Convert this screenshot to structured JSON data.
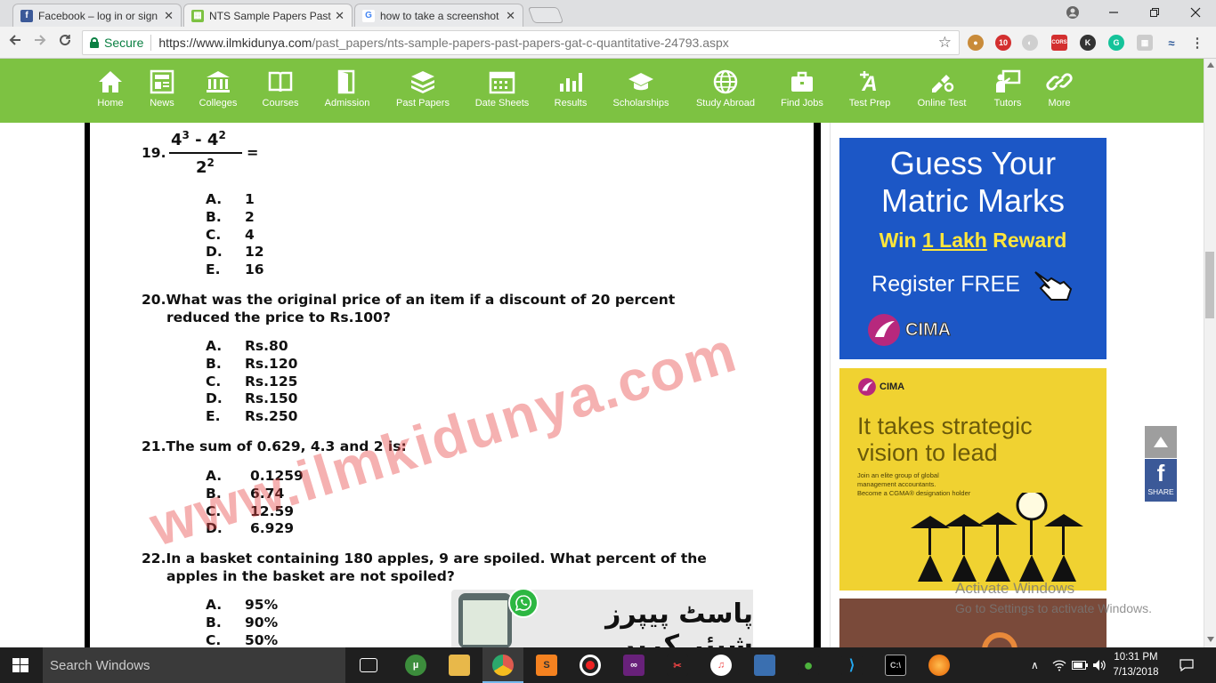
{
  "browser": {
    "tabs": [
      {
        "title": "Facebook – log in or sign",
        "icon_color": "#3b5998",
        "icon_glyph": "f"
      },
      {
        "title": "NTS Sample Papers Past P",
        "icon_color": "#7dc242",
        "icon_glyph": "▦"
      },
      {
        "title": "how to take a screenshot",
        "icon_color": "#ffffff",
        "icon_glyph": "G"
      }
    ],
    "tab_close": "✕",
    "secure_label": "Secure",
    "url_host": "https://www.ilmkidunya.com",
    "url_path": "/past_papers/nts-sample-papers-past-papers-gat-c-quantitative-24793.aspx",
    "ext_badge": "10",
    "ext_cors": "CORS",
    "ext_k": "K",
    "ext_g": "G"
  },
  "site_nav": [
    {
      "label": "Home",
      "icon": "home-icon"
    },
    {
      "label": "News",
      "icon": "news-icon"
    },
    {
      "label": "Colleges",
      "icon": "college-icon"
    },
    {
      "label": "Courses",
      "icon": "book-icon"
    },
    {
      "label": "Admission",
      "icon": "door-icon"
    },
    {
      "label": "Past Papers",
      "icon": "papers-icon"
    },
    {
      "label": "Date Sheets",
      "icon": "calendar-icon"
    },
    {
      "label": "Results",
      "icon": "results-chart-icon"
    },
    {
      "label": "Scholarships",
      "icon": "graduation-cap-icon"
    },
    {
      "label": "Study Abroad",
      "icon": "globe-icon"
    },
    {
      "label": "Find Jobs",
      "icon": "briefcase-icon"
    },
    {
      "label": "Test Prep",
      "icon": "test-prep-icon"
    },
    {
      "label": "Online Test",
      "icon": "online-test-icon"
    },
    {
      "label": "Tutors",
      "icon": "tutor-icon"
    },
    {
      "label": "More",
      "icon": "link-icon"
    }
  ],
  "paper": {
    "q19": {
      "number": "19.",
      "numerator_base1": "4",
      "numerator_exp1": "3",
      "minus": " - ",
      "numerator_base2": "4",
      "numerator_exp2": "2",
      "denominator_base": "2",
      "denominator_exp": "2",
      "equals": "=",
      "options": [
        {
          "letter": "A.",
          "value": "1"
        },
        {
          "letter": "B.",
          "value": "2"
        },
        {
          "letter": "C.",
          "value": "4"
        },
        {
          "letter": "D.",
          "value": "12"
        },
        {
          "letter": "E.",
          "value": "16"
        }
      ]
    },
    "q20": {
      "line1": "20.What was the original price of an item if a discount of 20 percent",
      "line2": "reduced the price to Rs.100?",
      "options": [
        {
          "letter": "A.",
          "value": "Rs.80"
        },
        {
          "letter": "B.",
          "value": "Rs.120"
        },
        {
          "letter": "C.",
          "value": "Rs.125"
        },
        {
          "letter": "D.",
          "value": "Rs.150"
        },
        {
          "letter": "E.",
          "value": "Rs.250"
        }
      ]
    },
    "q21": {
      "line1": "21.The sum of 0.629, 4.3 and 2 is:",
      "options": [
        {
          "letter": "A.",
          "value": "0.1259"
        },
        {
          "letter": "B.",
          "value": "6.74"
        },
        {
          "letter": "C.",
          "value": "12.59"
        },
        {
          "letter": "D.",
          "value": "6.929"
        }
      ]
    },
    "q22": {
      "line1": "22.In a basket containing 180 apples, 9 are spoiled. What percent of the",
      "line2": "apples in the basket are not spoiled?",
      "options": [
        {
          "letter": "A.",
          "value": "95%"
        },
        {
          "letter": "B.",
          "value": "90%"
        },
        {
          "letter": "C.",
          "value": "50%"
        }
      ]
    },
    "watermark": "www.ilmkidunya.com",
    "share_urdu": "پاسٹ پیپرز شیئر کریں۔"
  },
  "ads": {
    "ad1": {
      "headline_1": "Guess Your",
      "headline_2": "Matric Marks",
      "win_prefix": "Win ",
      "win_emph": "1 Lakh",
      "win_suffix": " Reward",
      "register": "Register FREE",
      "brand": "CIMA"
    },
    "ad2": {
      "brand": "CIMA",
      "tagline_1": "It takes strategic",
      "tagline_2": "vision to lead",
      "small_1": "Join an elite group of global",
      "small_2": "management accountants.",
      "small_3": "Become a CGMA® designation holder"
    }
  },
  "fb_share_label": "SHARE",
  "activate": {
    "title": "Activate Windows",
    "subtitle": "Go to Settings to activate Windows."
  },
  "taskbar": {
    "search_placeholder": "Search Windows",
    "time": "10:31 PM",
    "date": "7/13/2018"
  }
}
